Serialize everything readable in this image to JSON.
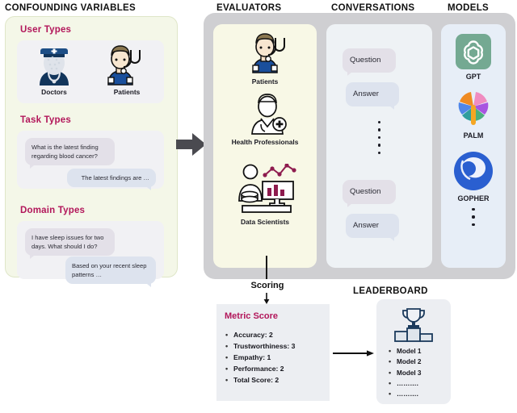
{
  "headings": {
    "confounding": "CONFOUNDING VARIABLES",
    "evaluators": "EVALUATORS",
    "conversations": "CONVERSATIONS",
    "models": "MODELS",
    "leaderboard": "LEADERBOARD"
  },
  "confounding": {
    "sections": [
      {
        "label": "User Types"
      },
      {
        "label": "Task Types"
      },
      {
        "label": "Domain Types"
      }
    ],
    "user_types": [
      {
        "label": "Doctors",
        "icon": "doctor-icon"
      },
      {
        "label": "Patients",
        "icon": "patient-with-stethoscope-icon"
      }
    ],
    "task_types_chat": [
      {
        "role": "question",
        "text": "What is the latest finding regarding blood cancer?"
      },
      {
        "role": "answer",
        "text": "The latest findings are …"
      }
    ],
    "domain_types_chat": [
      {
        "role": "question",
        "text": "I have sleep issues for two days. What should I do?"
      },
      {
        "role": "answer",
        "text": "Based on your recent sleep patterns …"
      }
    ]
  },
  "evaluators": [
    {
      "label": "Patients",
      "icon": "patient-icon"
    },
    {
      "label": "Health Professionals",
      "icon": "health-professional-icon"
    },
    {
      "label": "Data Scientists",
      "icon": "data-scientist-icon"
    }
  ],
  "conversations": {
    "bubbles": [
      {
        "role": "question",
        "text": "Question"
      },
      {
        "role": "answer",
        "text": "Answer"
      },
      {
        "role": "question",
        "text": "Question"
      },
      {
        "role": "answer",
        "text": "Answer"
      }
    ],
    "ellipsis_dots": 5
  },
  "models": {
    "items": [
      {
        "label": "GPT",
        "icon": "openai-logo-icon"
      },
      {
        "label": "PALM",
        "icon": "palm-pinwheel-logo-icon"
      },
      {
        "label": "GOPHER",
        "icon": "gopher-swirl-logo-icon"
      }
    ],
    "ellipsis_dots": 3
  },
  "flow": {
    "scoring_label": "Scoring"
  },
  "metric": {
    "title": "Metric Score",
    "items": [
      "Accuracy: 2",
      "Trustworthiness: 3",
      "Empathy: 1",
      "Performance: 2",
      "Total Score: 2"
    ]
  },
  "leaderboard": {
    "icon": "trophy-podium-icon",
    "items": [
      "Model 1",
      "Model 2",
      "Model 3",
      "……….",
      "………."
    ]
  },
  "colors": {
    "accent_magenta": "#b2165a",
    "panel_gray": "#cfcfd2",
    "eval_cream": "#f8f8e6",
    "conv_bg": "#eef2f5",
    "models_bg": "#e7eef7",
    "cv_bg": "#f4f7e8",
    "bubble_question": "#e3e0e8",
    "bubble_answer": "#dde3ee",
    "navy": "#1b3a5c",
    "gpt_green": "#74a992",
    "gopher_blue": "#2a5fd0"
  }
}
